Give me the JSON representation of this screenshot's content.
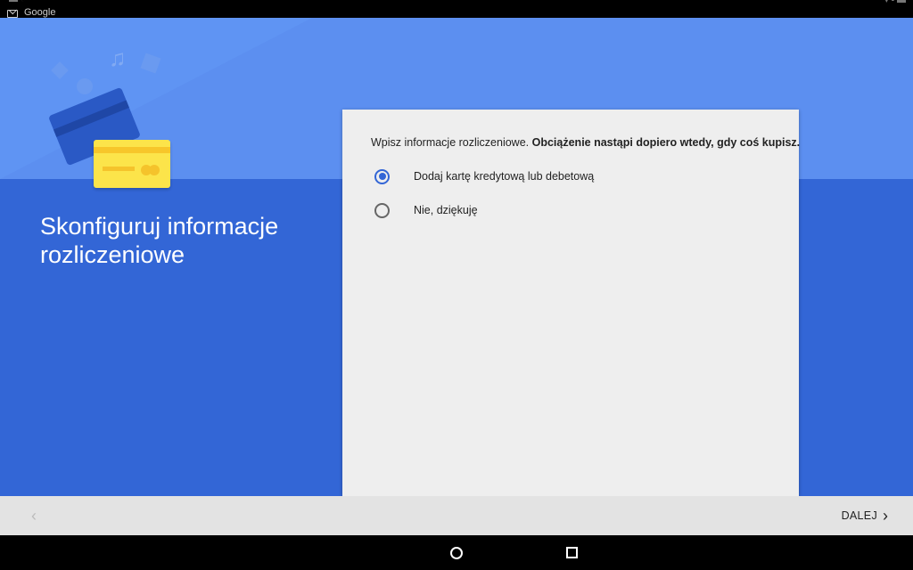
{
  "status_bar": {
    "notification_text": "Google",
    "notification_icon": "gmail-icon"
  },
  "header": {
    "title": "Skonfiguruj informacje rozliczeniowe",
    "illustration": [
      "credit-card-icon",
      "music-note-icon"
    ]
  },
  "card": {
    "info_normal": "Wpisz informacje rozliczeniowe.",
    "info_bold": "Obciążenie nastąpi dopiero wtedy, gdy coś kupisz.",
    "options": [
      {
        "label": "Dodaj kartę kredytową lub debetową",
        "selected": true
      },
      {
        "label": "Nie, dziękuję",
        "selected": false
      }
    ]
  },
  "footer": {
    "back_icon": "chevron-left-icon",
    "next_label": "DALEJ",
    "next_icon": "chevron-right-icon"
  },
  "nav_bar": {
    "icons": [
      "home-icon",
      "recents-icon"
    ]
  },
  "colors": {
    "primary": "#3366d6",
    "header_light": "#5c8ff0",
    "card_bg": "#eeeeee",
    "card_yellow": "#fce44a"
  }
}
